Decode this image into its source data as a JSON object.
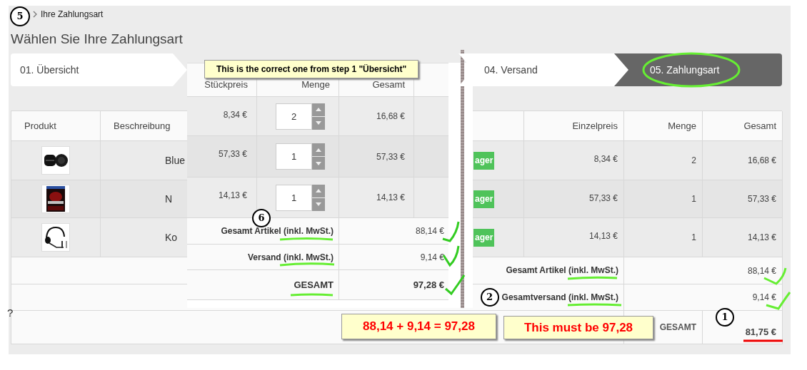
{
  "breadcrumb": {
    "marker": "5",
    "label": "Ihre Zahlungsart"
  },
  "heading": "Wählen Sie Ihre Zahlungsart",
  "steps": [
    {
      "label": "01. Übersicht",
      "selected": false
    },
    {
      "label": "04. Versand",
      "selected": false
    },
    {
      "label": "05. Zahlungsart",
      "selected": true
    }
  ],
  "cart": {
    "columns": [
      "Produkt",
      "Beschreibung",
      "Einzelpreis",
      "Menge",
      "Gesamt"
    ],
    "rows": [
      {
        "description": "Blue",
        "status": "ager",
        "unit_price": "8,34 €",
        "quantity": "2",
        "total": "16,68 €"
      },
      {
        "description": "N",
        "status": "ager",
        "unit_price": "57,33 €",
        "quantity": "1",
        "total": "57,33 €"
      },
      {
        "description": "Ko",
        "status": "ager",
        "unit_price": "14,13 €",
        "quantity": "1",
        "total": "14,13 €"
      }
    ],
    "summary": [
      {
        "kind": "subtotal",
        "label": "Gesamt Artikel (inkl. MwSt.)",
        "value": "88,14 €"
      },
      {
        "kind": "subtotal",
        "marker": "2",
        "label": "Gesamtversand (inkl. MwSt.)",
        "value": "9,14 €"
      },
      {
        "kind": "total",
        "marker": "1",
        "label": "GESAMT",
        "value": "81,75 €"
      }
    ]
  },
  "overlay": {
    "note": "This is the correct one from step 1 \"Übersicht\"",
    "columns": [
      "Stückpreis",
      "Menge",
      "Gesamt"
    ],
    "rows": [
      {
        "unit_price": "8,34 €",
        "quantity": "2",
        "total": "16,68 €"
      },
      {
        "unit_price": "57,33 €",
        "quantity": "1",
        "total": "57,33 €"
      },
      {
        "unit_price": "14,13 €",
        "quantity": "1",
        "total": "14,13 €"
      }
    ],
    "summary": [
      {
        "kind": "subtotal",
        "marker": "6",
        "label": "Gesamt Artikel (inkl. MwSt.)",
        "value": "88,14 €"
      },
      {
        "kind": "subtotal",
        "label": "Versand (inkl. MwSt.)",
        "value": "9,14 €"
      },
      {
        "kind": "total",
        "label": "GESAMT",
        "value": "97,28 €"
      }
    ]
  },
  "callouts": [
    "88,14 + 9,14 = 97,28",
    "This must be 97,28"
  ],
  "stray_text": "?"
}
